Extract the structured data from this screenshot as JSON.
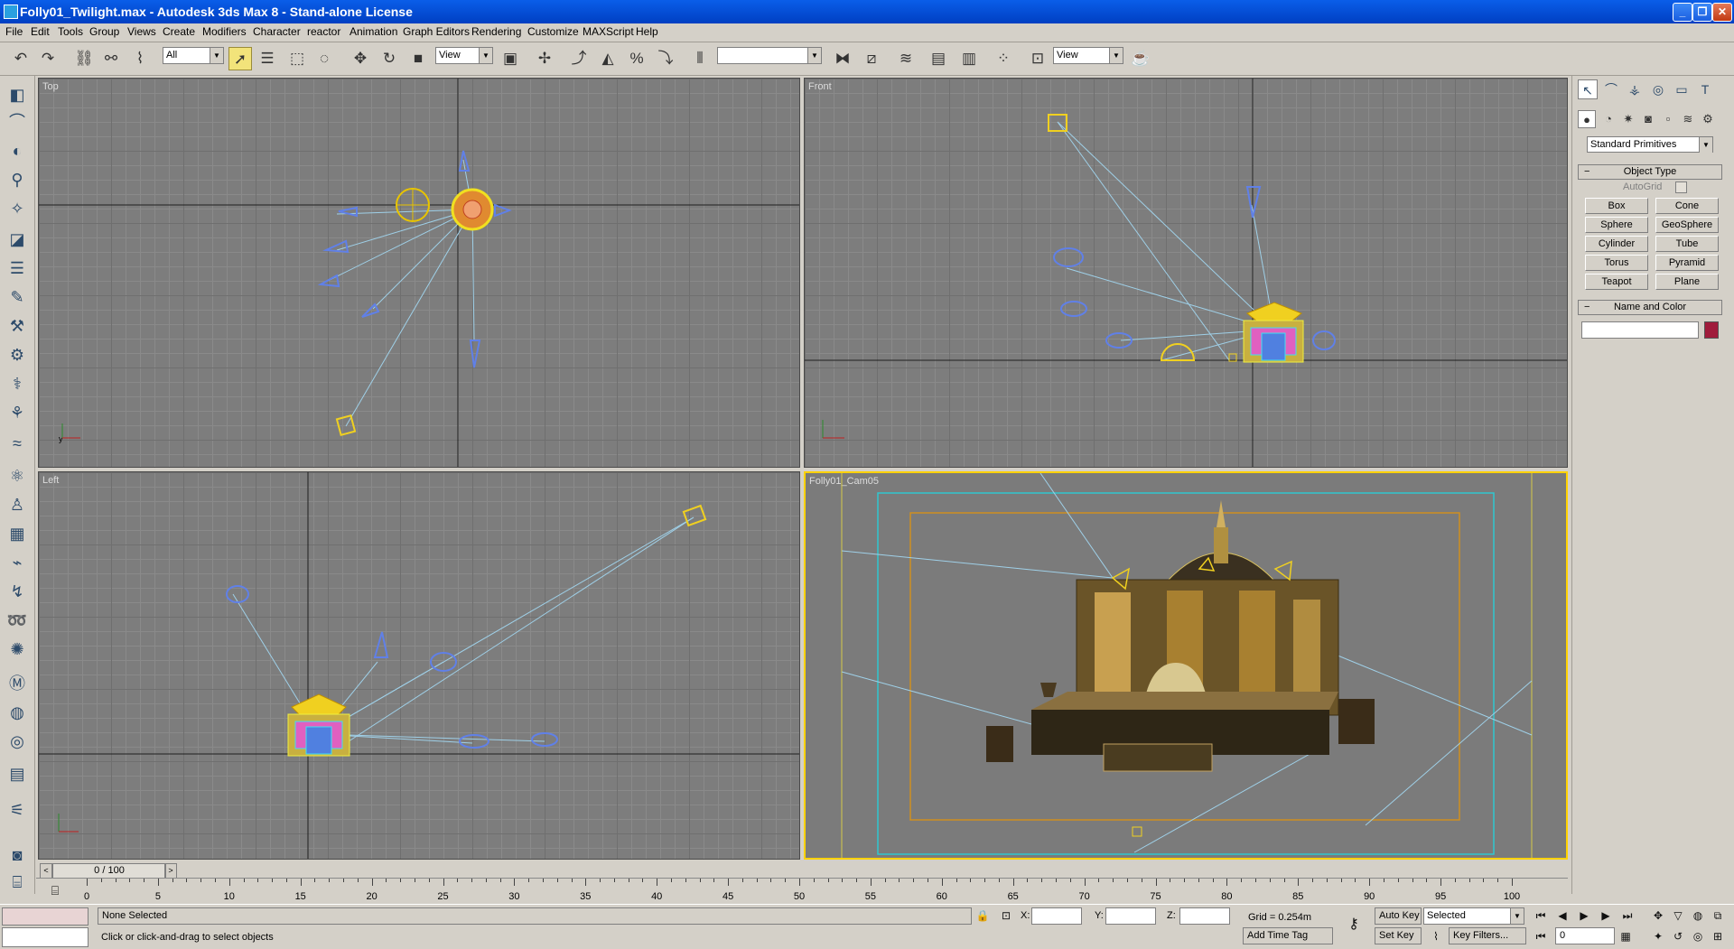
{
  "window": {
    "title": "Folly01_Twilight.max - Autodesk 3ds Max 8   - Stand-alone License",
    "minimize": "_",
    "restore": "❐",
    "close": "✕"
  },
  "menu": [
    "File",
    "Edit",
    "Tools",
    "Group",
    "Views",
    "Create",
    "Modifiers",
    "Character",
    "reactor",
    "Animation",
    "Graph Editors",
    "Rendering",
    "Customize",
    "MAXScript",
    "Help"
  ],
  "toolbar": {
    "selection_filter": "All",
    "ref_coord": "View",
    "named_selection": "",
    "render_view": "View"
  },
  "viewports": {
    "top": "Top",
    "front": "Front",
    "left": "Left",
    "camera": "Folly01_Cam05"
  },
  "command_panel": {
    "category": "Standard Primitives",
    "object_type_header": "Object Type",
    "autogrid": "AutoGrid",
    "buttons": [
      "Box",
      "Cone",
      "Sphere",
      "GeoSphere",
      "Cylinder",
      "Tube",
      "Torus",
      "Pyramid",
      "Teapot",
      "Plane"
    ],
    "name_color_header": "Name and Color",
    "object_name": "",
    "object_color": "#a01c3c"
  },
  "timeline": {
    "frame": "0 / 100",
    "ticks": [
      "0",
      "5",
      "10",
      "15",
      "20",
      "25",
      "30",
      "35",
      "40",
      "45",
      "50",
      "55",
      "60",
      "65",
      "70",
      "75",
      "80",
      "85",
      "90",
      "95",
      "100"
    ]
  },
  "status": {
    "selection": "None Selected",
    "prompt": "Click or click-and-drag to select objects",
    "x_label": "X:",
    "y_label": "Y:",
    "z_label": "Z:",
    "x": "",
    "y": "",
    "z": "",
    "grid": "Grid = 0.254m",
    "add_time_tag": "Add Time Tag",
    "auto_key": "Auto Key",
    "set_key": "Set Key",
    "key_mode": "Selected",
    "key_filters": "Key Filters...",
    "current_frame": "0"
  },
  "colors": {
    "selected_viewport_border": "#ffd200",
    "light_color": "#5a78e0",
    "camera_color": "#f0d020"
  }
}
